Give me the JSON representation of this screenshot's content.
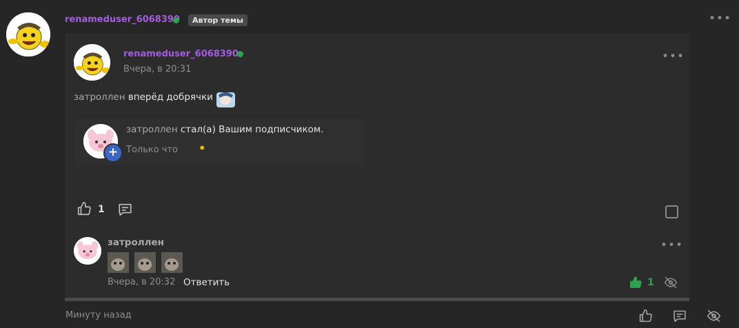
{
  "post": {
    "author": "renameduser_6068390",
    "author_badge": "Автор темы",
    "timestamp": "Минуту назад",
    "menu_icon": "more-dots-icon",
    "actions": [
      "like-icon",
      "comment-icon",
      "hide-icon"
    ]
  },
  "quoted_post": {
    "author": "renameduser_6068390",
    "timestamp": "Вчера, в 20:31",
    "text_author": "затроллен",
    "text_rest": " вперёд добрячки",
    "like_count": "1",
    "notification": {
      "user": "затроллен",
      "text": " стал(а) Вашим подписчиком.",
      "time": "Только что"
    }
  },
  "comment": {
    "author": "затроллен",
    "timestamp": "Вчера, в 20:32",
    "reply_label": "Ответить",
    "like_count": "1"
  },
  "colors": {
    "background": "#262626",
    "panel": "#2c2c2c",
    "username": "#a55de0",
    "online": "#2fa24d",
    "liked": "#2fa24d"
  }
}
